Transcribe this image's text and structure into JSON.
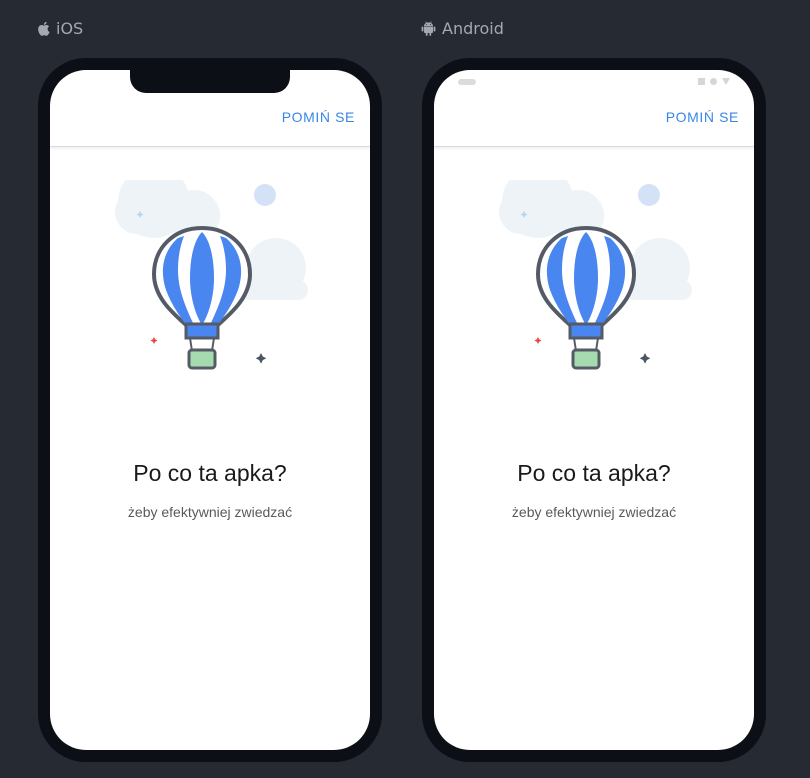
{
  "platforms": {
    "ios": {
      "label": "iOS",
      "icon": "apple-icon"
    },
    "android": {
      "label": "Android",
      "icon": "android-icon"
    }
  },
  "onboarding": {
    "skip_label": "POMIŃ SE",
    "title": "Po co ta apka?",
    "subtitle": "żeby efektywniej zwiedzać",
    "illustration": "hot-air-balloon-illustration"
  },
  "colors": {
    "background": "#252a33",
    "device_frame": "#0c0f15",
    "accent": "#3a86e8",
    "balloon_blue": "#4a86f0",
    "basket_green": "#a6dbb0",
    "cloud": "#eef3f8"
  }
}
